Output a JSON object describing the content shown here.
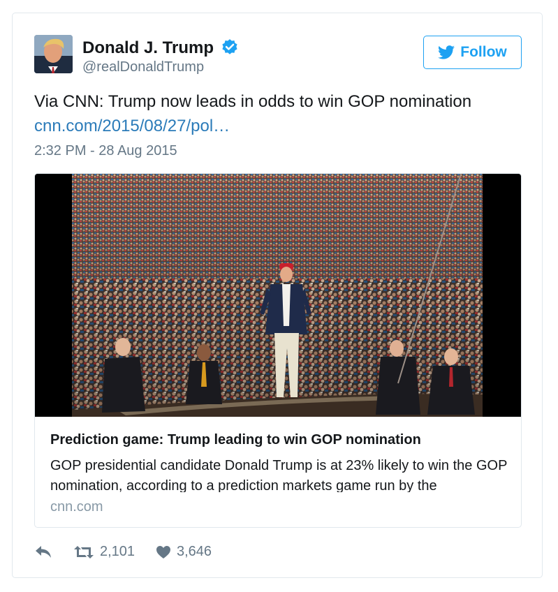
{
  "user": {
    "display_name": "Donald J. Trump",
    "screen_name": "@realDonaldTrump",
    "verified": true
  },
  "follow_button": {
    "label": "Follow",
    "icon": "twitter-bird-icon"
  },
  "tweet": {
    "text": "Via CNN: Trump now leads in odds to win GOP nomination",
    "link_text": "cnn.com/2015/08/27/pol…",
    "timestamp": "2:32 PM - 28 Aug 2015"
  },
  "card": {
    "title": "Prediction game: Trump leading to win GOP nomination",
    "description": "GOP presidential candidate Donald Trump is at 23% likely to win the GOP nomination, according to a prediction markets game run by the",
    "domain": "cnn.com"
  },
  "actions": {
    "reply_icon": "reply-icon",
    "retweet_icon": "retweet-icon",
    "retweet_count": "2,101",
    "like_icon": "heart-icon",
    "like_count": "3,646"
  },
  "colors": {
    "accent": "#1da1f2",
    "link": "#2b7bb9",
    "muted": "#657786",
    "border": "#e1e8ed"
  }
}
